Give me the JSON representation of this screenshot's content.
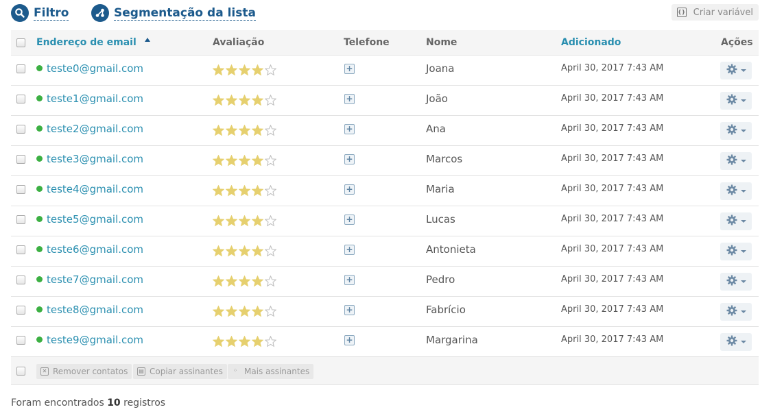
{
  "toolbar": {
    "filter_label": "Filtro",
    "segment_label": "Segmentação da lista",
    "create_variable_label": "Criar variável"
  },
  "table": {
    "columns": {
      "email": "Endereço de email",
      "rating": "Avaliação",
      "phone": "Telefone",
      "name": "Nome",
      "added": "Adicionado",
      "actions": "Ações"
    },
    "sort": {
      "column": "email",
      "direction": "ascending"
    },
    "colors": {
      "link": "#2a8fb0",
      "active_dot": "#3cb043",
      "star_filled": "#e6d06f",
      "accent": "#1c5a8c"
    },
    "rows": [
      {
        "email": "teste0@gmail.com",
        "rating": 4,
        "name": "Joana",
        "added": "April 30, 2017 7:43 AM"
      },
      {
        "email": "teste1@gmail.com",
        "rating": 4,
        "name": "João",
        "added": "April 30, 2017 7:43 AM"
      },
      {
        "email": "teste2@gmail.com",
        "rating": 4,
        "name": "Ana",
        "added": "April 30, 2017 7:43 AM"
      },
      {
        "email": "teste3@gmail.com",
        "rating": 4,
        "name": "Marcos",
        "added": "April 30, 2017 7:43 AM"
      },
      {
        "email": "teste4@gmail.com",
        "rating": 4,
        "name": "Maria",
        "added": "April 30, 2017 7:43 AM"
      },
      {
        "email": "teste5@gmail.com",
        "rating": 4,
        "name": "Lucas",
        "added": "April 30, 2017 7:43 AM"
      },
      {
        "email": "teste6@gmail.com",
        "rating": 4,
        "name": "Antonieta",
        "added": "April 30, 2017 7:43 AM"
      },
      {
        "email": "teste7@gmail.com",
        "rating": 4,
        "name": "Pedro",
        "added": "April 30, 2017 7:43 AM"
      },
      {
        "email": "teste8@gmail.com",
        "rating": 4,
        "name": "Fabrício",
        "added": "April 30, 2017 7:43 AM"
      },
      {
        "email": "teste9@gmail.com",
        "rating": 4,
        "name": "Margarina",
        "added": "April 30, 2017 7:43 AM"
      }
    ],
    "rating_max": 5
  },
  "bulk_actions": {
    "remove_label": "Remover contatos",
    "copy_label": "Copiar assinantes",
    "more_label": "Mais assinantes"
  },
  "summary": {
    "prefix": "Foram encontrados",
    "count": "10",
    "suffix": "registros"
  }
}
